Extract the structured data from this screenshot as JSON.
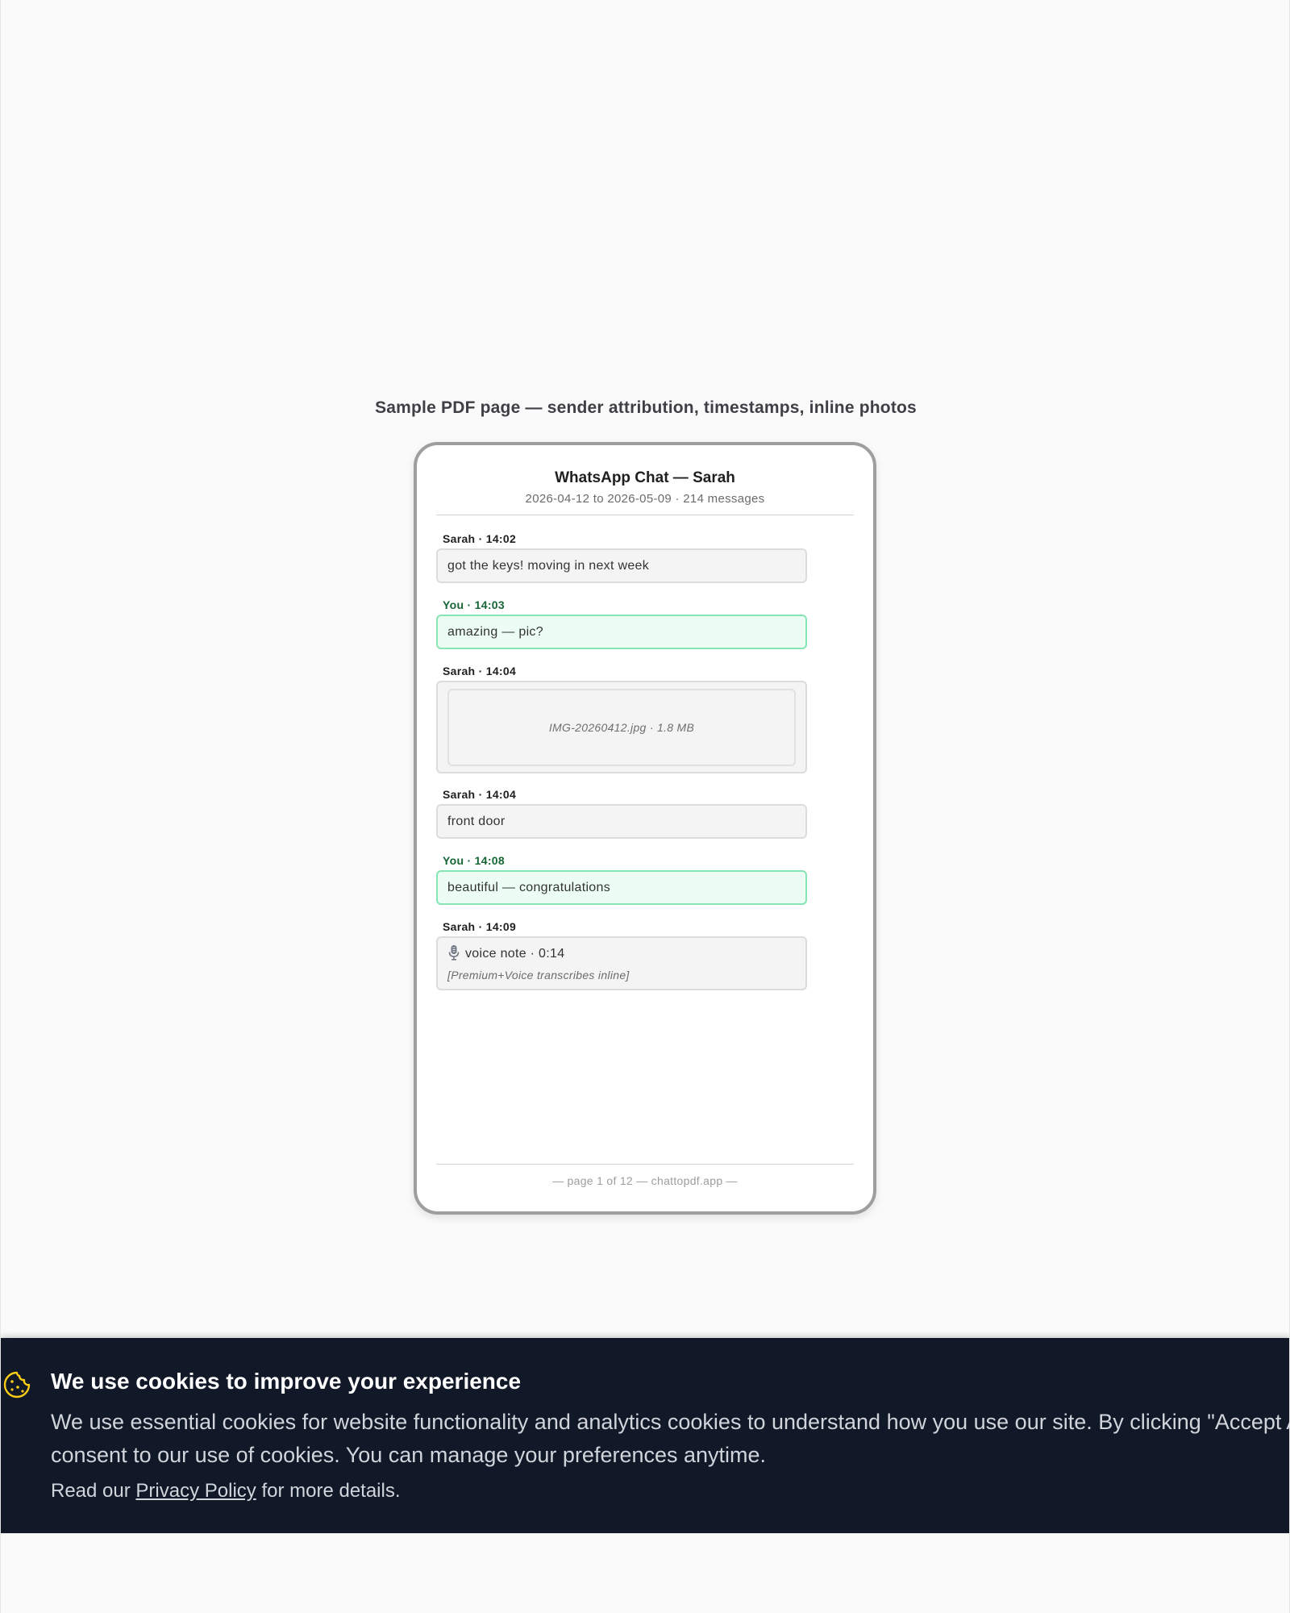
{
  "caption": "Sample PDF page — sender attribution, timestamps, inline photos",
  "pdf": {
    "title": "WhatsApp Chat — Sarah",
    "subtitle": "2026-04-12 to 2026-05-09 · 214 messages",
    "messages": [
      {
        "meta": "Sarah · 14:02",
        "text": "got the keys! moving in next week"
      },
      {
        "meta": "You · 14:03",
        "text": "amazing — pic?"
      },
      {
        "meta": "Sarah · 14:04",
        "photo": "IMG-20260412.jpg · 1.8 MB"
      },
      {
        "meta": "Sarah · 14:04",
        "text": "front door"
      },
      {
        "meta": "You · 14:08",
        "text": "beautiful — congratulations"
      },
      {
        "meta": "Sarah · 14:09",
        "voice": "voice note · 0:14",
        "voice_sub": "[Premium+Voice transcribes inline]"
      }
    ],
    "footer": "— page 1 of 12 — chattopdf.app —"
  },
  "cookie": {
    "icon": "cookie-icon",
    "title": "We use cookies to improve your experience",
    "body": "We use essential cookies for website functionality and analytics cookies to understand how you use our site. By clicking \"Accept All\", you consent to our use of cookies. You can manage your preferences anytime.",
    "policy_prefix": "Read our ",
    "policy_link": "Privacy Policy",
    "policy_suffix": " for more details."
  },
  "colors": {
    "banner_bg": "#111827",
    "you_bubble_bg": "#ecfdf3",
    "you_bubble_border": "#86e5b5",
    "you_meta": "#166534",
    "cookie_icon": "#facc15"
  }
}
